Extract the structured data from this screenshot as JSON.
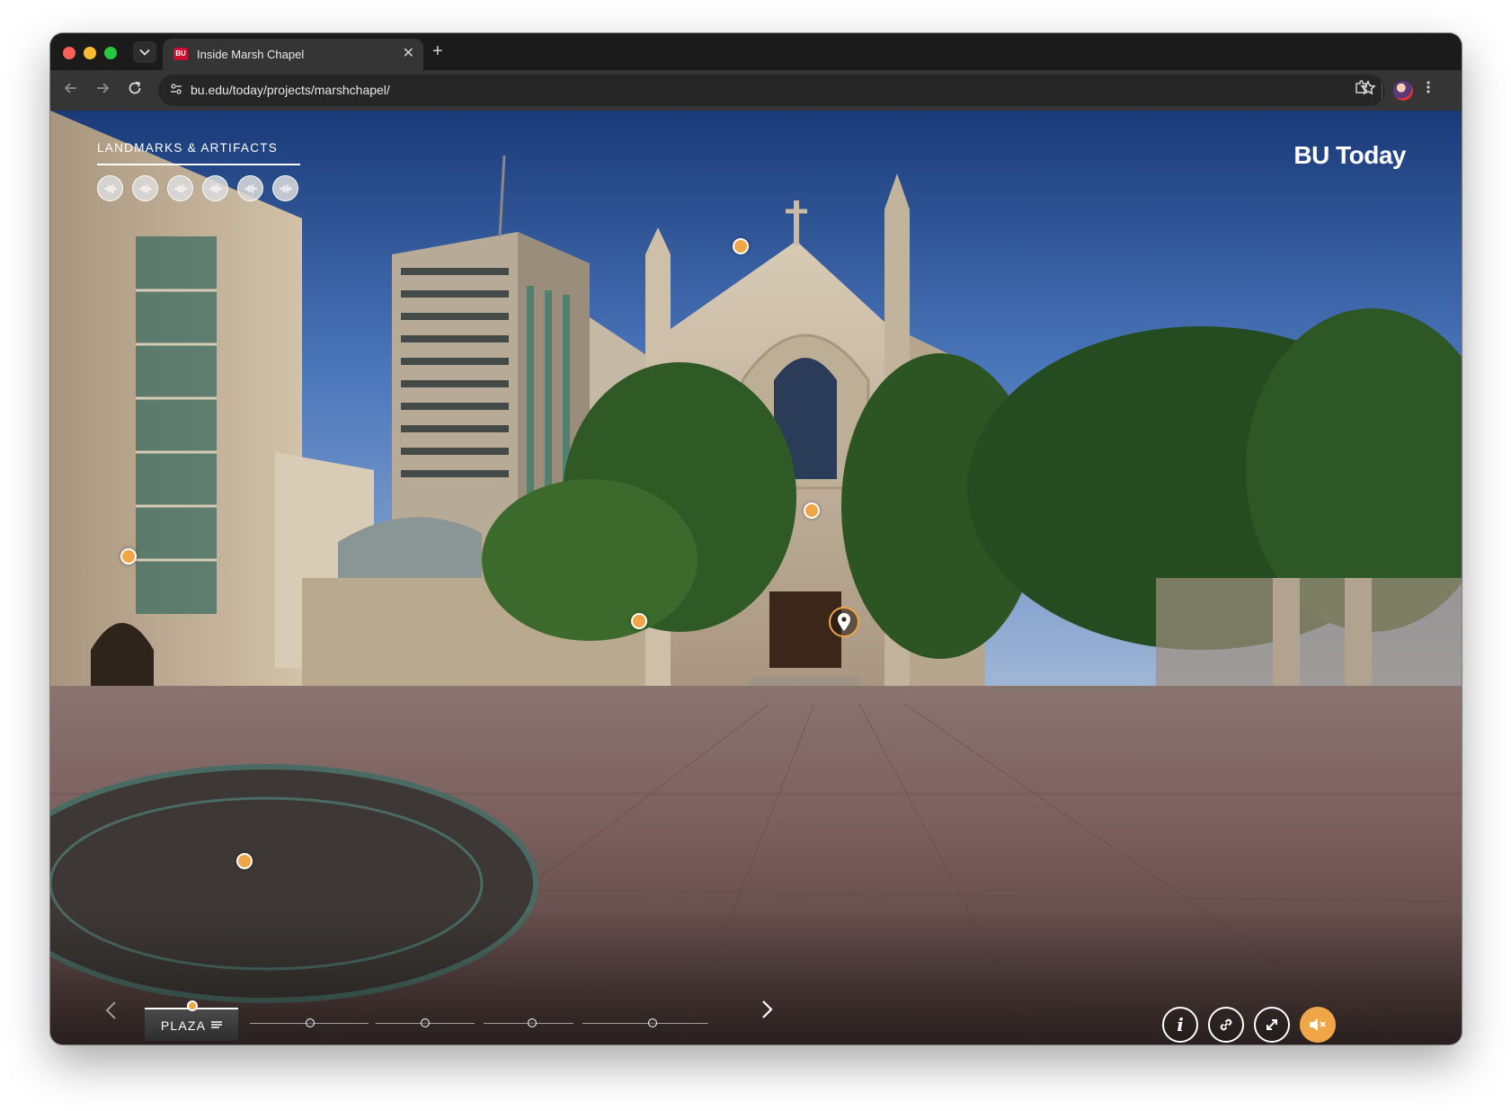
{
  "browser": {
    "tab": {
      "title": "Inside Marsh Chapel",
      "favicon_text": "BU",
      "close_glyph": "✕"
    },
    "new_tab_glyph": "+",
    "url": "bu.edu/today/projects/marshchapel/",
    "icons": {
      "back": "arrow-left-icon",
      "forward": "arrow-right-icon",
      "reload": "reload-icon",
      "bookmark": "star-icon",
      "extensions": "puzzle-icon",
      "menu": "kebab-menu-icon"
    },
    "colors": {
      "tab_bar": "#1b1b1b",
      "toolbar": "#353535",
      "omnibox": "#262626"
    }
  },
  "tour": {
    "section_title": "LANDMARKS & ARTIFACTS",
    "audio_clip_count": 6,
    "brand": "BU Today",
    "scene_label": "PLAZA",
    "accent_color": "#f0a646"
  }
}
